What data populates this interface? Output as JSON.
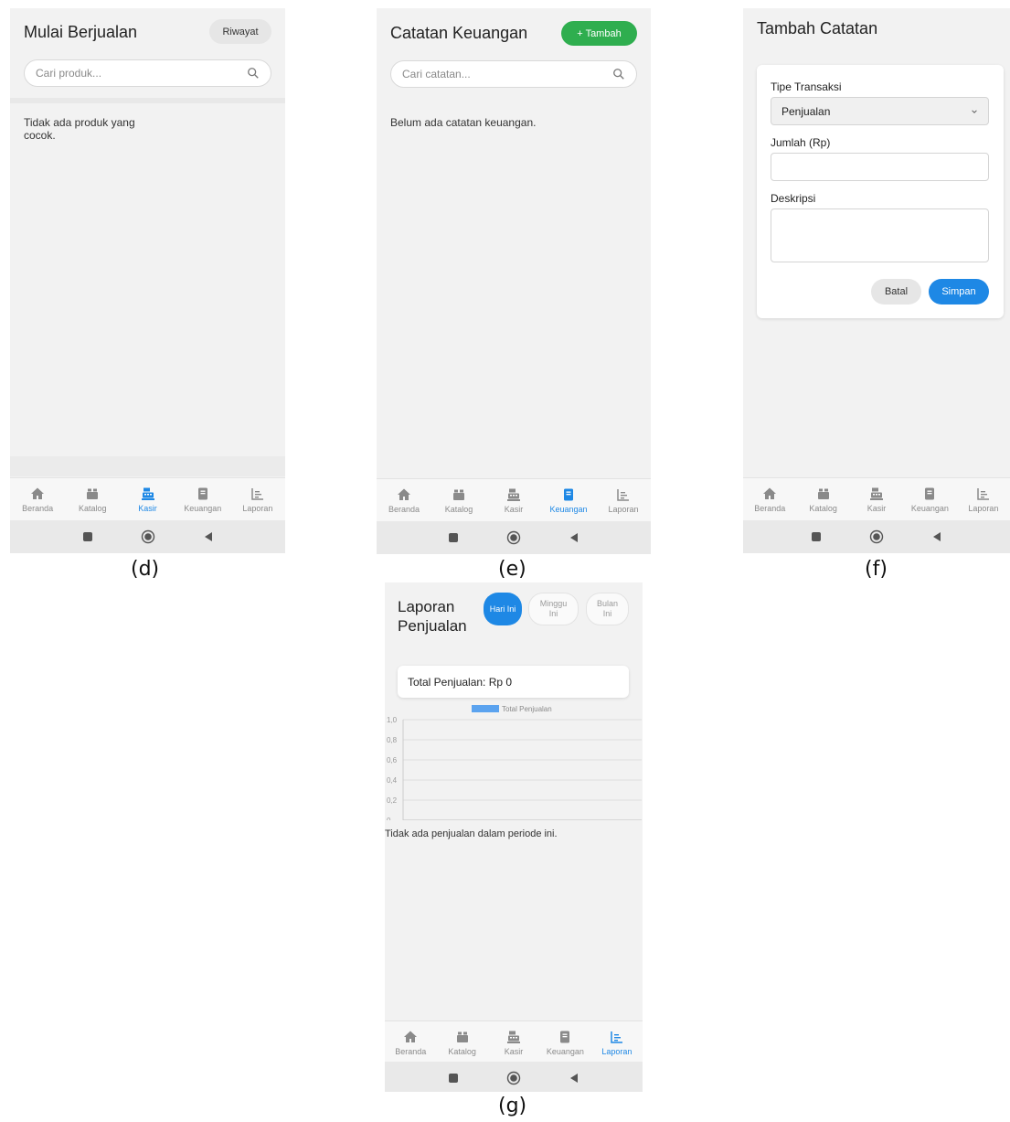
{
  "nav": {
    "items": [
      "Beranda",
      "Katalog",
      "Kasir",
      "Keuangan",
      "Laporan"
    ]
  },
  "colors": {
    "accent": "#1e88e5",
    "green": "#2fae4f",
    "background": "#f2f2f2",
    "bar": "#5ba3ef"
  },
  "screen_d": {
    "title": "Mulai Berjualan",
    "history_button": "Riwayat",
    "search_placeholder": "Cari produk...",
    "empty_message": "Tidak ada produk yang cocok.",
    "active_tab": "Kasir",
    "caption": "(d)"
  },
  "screen_e": {
    "title": "Catatan Keuangan",
    "add_button": "+ Tambah",
    "search_placeholder": "Cari catatan...",
    "empty_message": "Belum ada catatan keuangan.",
    "active_tab": "Keuangan",
    "caption": "(e)"
  },
  "screen_f": {
    "title": "Tambah Catatan",
    "type_label": "Tipe Transaksi",
    "type_value": "Penjualan",
    "amount_label": "Jumlah (Rp)",
    "amount_value": "",
    "description_label": "Deskripsi",
    "description_value": "",
    "cancel_button": "Batal",
    "save_button": "Simpan",
    "caption": "(f)"
  },
  "screen_g": {
    "title": "Laporan Penjualan",
    "periods": [
      "Hari Ini",
      "Minggu Ini",
      "Bulan Ini"
    ],
    "active_period": "Hari Ini",
    "total": "Total Penjualan: Rp 0",
    "empty_message": "Tidak ada penjualan dalam periode ini.",
    "active_tab": "Laporan",
    "caption": "(g)"
  },
  "chart_data": {
    "type": "bar",
    "categories": [],
    "series": [
      {
        "name": "Total Penjualan",
        "values": []
      }
    ],
    "ylim": [
      0,
      1.0
    ],
    "yticks": [
      "0",
      "0,2",
      "0,4",
      "0,6",
      "0,8",
      "1,0"
    ],
    "grid": true,
    "legend": "top"
  }
}
